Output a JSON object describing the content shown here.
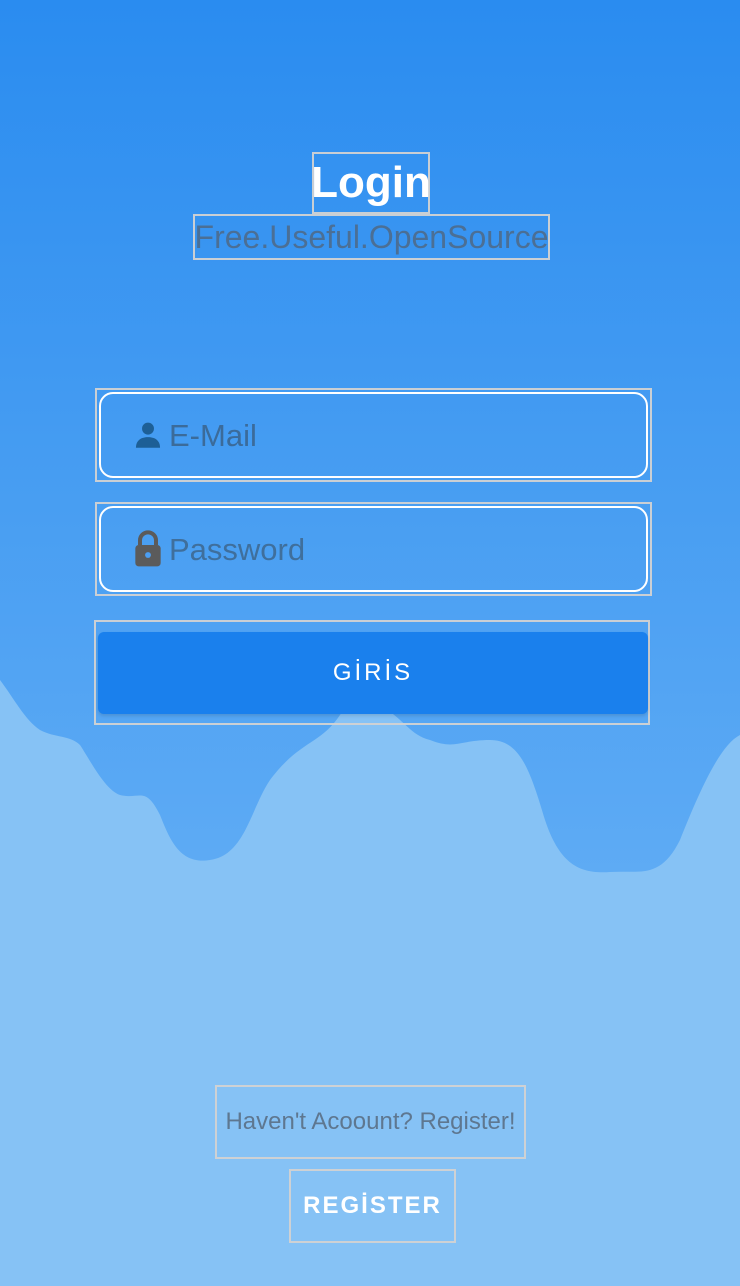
{
  "header": {
    "title": "Login",
    "subtitle": "Free.Useful.OpenSource"
  },
  "form": {
    "email_placeholder": "E-Mail",
    "password_placeholder": "Password",
    "login_label": "GİRİS",
    "email_icon": "person-icon",
    "password_icon": "lock-icon"
  },
  "footer": {
    "no_account_text": "Haven't Acoount? Register!",
    "register_label": "REGİSTER"
  },
  "colors": {
    "bg_top": "#2a8cf0",
    "bg_wave": "#5eabf4",
    "bg_bottom": "#86c2f5",
    "button": "#1a80ed",
    "icon_user": "#1d5f96",
    "icon_lock": "#5b5b5b"
  }
}
